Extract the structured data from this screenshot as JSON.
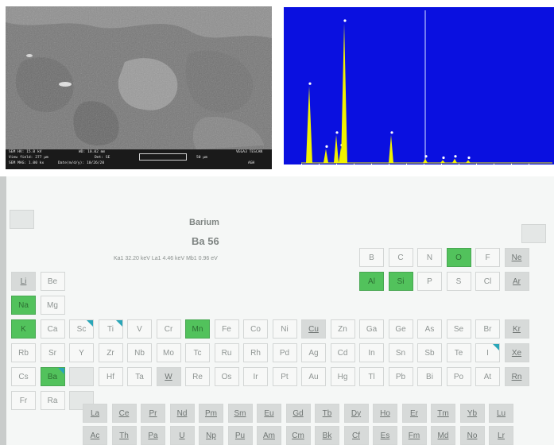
{
  "sem": {
    "row1": [
      "SEM HV: 15.0 kV",
      "WD: 10.02 mm",
      "VEGA3 TESCAN"
    ],
    "row2": [
      "View field: 277 µm",
      "Det: SE",
      "50 µm"
    ],
    "row3": [
      "SEM MAG: 1.00 kx",
      "Date(m/d/y): 10/26/20",
      "AGH"
    ]
  },
  "eds": {
    "colors": {
      "background": "#0a10e0",
      "peak": "#f2f200",
      "marker": "#ffffff",
      "cursor": "#b8c0ff"
    },
    "peaks_relative": [
      0.55,
      0.1,
      0.2,
      0.11,
      1.0,
      0.2,
      0.03,
      0.02,
      0.03,
      0.02
    ]
  },
  "periodic": {
    "info": {
      "name": "Barium",
      "symbol_line": "Ba 56",
      "lines": "Ka1 32.20 keV   La1 4.46 keV   Mb1 0.96 eV"
    },
    "elements": [
      {
        "s": "Li",
        "c": 0,
        "r": 1,
        "st": "grey ul"
      },
      {
        "s": "Be",
        "c": 1,
        "r": 1
      },
      {
        "s": "Na",
        "c": 0,
        "r": 2,
        "st": "sel"
      },
      {
        "s": "Mg",
        "c": 1,
        "r": 2
      },
      {
        "s": "K",
        "c": 0,
        "r": 3,
        "st": "sel"
      },
      {
        "s": "Ca",
        "c": 1,
        "r": 3
      },
      {
        "s": "Sc",
        "c": 2,
        "r": 3,
        "tri": true
      },
      {
        "s": "Ti",
        "c": 3,
        "r": 3,
        "tri": true
      },
      {
        "s": "V",
        "c": 4,
        "r": 3
      },
      {
        "s": "Cr",
        "c": 5,
        "r": 3
      },
      {
        "s": "Mn",
        "c": 6,
        "r": 3,
        "st": "sel"
      },
      {
        "s": "Fe",
        "c": 7,
        "r": 3
      },
      {
        "s": "Co",
        "c": 8,
        "r": 3
      },
      {
        "s": "Ni",
        "c": 9,
        "r": 3
      },
      {
        "s": "Cu",
        "c": 10,
        "r": 3,
        "st": "grey ul"
      },
      {
        "s": "Zn",
        "c": 11,
        "r": 3
      },
      {
        "s": "Ga",
        "c": 12,
        "r": 3
      },
      {
        "s": "Ge",
        "c": 13,
        "r": 3
      },
      {
        "s": "As",
        "c": 14,
        "r": 3
      },
      {
        "s": "Se",
        "c": 15,
        "r": 3
      },
      {
        "s": "Br",
        "c": 16,
        "r": 3
      },
      {
        "s": "Kr",
        "c": 17,
        "r": 3,
        "st": "grey ul"
      },
      {
        "s": "Rb",
        "c": 0,
        "r": 4
      },
      {
        "s": "Sr",
        "c": 1,
        "r": 4
      },
      {
        "s": "Y",
        "c": 2,
        "r": 4
      },
      {
        "s": "Zr",
        "c": 3,
        "r": 4
      },
      {
        "s": "Nb",
        "c": 4,
        "r": 4
      },
      {
        "s": "Mo",
        "c": 5,
        "r": 4
      },
      {
        "s": "Tc",
        "c": 6,
        "r": 4
      },
      {
        "s": "Ru",
        "c": 7,
        "r": 4
      },
      {
        "s": "Rh",
        "c": 8,
        "r": 4
      },
      {
        "s": "Pd",
        "c": 9,
        "r": 4
      },
      {
        "s": "Ag",
        "c": 10,
        "r": 4
      },
      {
        "s": "Cd",
        "c": 11,
        "r": 4
      },
      {
        "s": "In",
        "c": 12,
        "r": 4
      },
      {
        "s": "Sn",
        "c": 13,
        "r": 4
      },
      {
        "s": "Sb",
        "c": 14,
        "r": 4
      },
      {
        "s": "Te",
        "c": 15,
        "r": 4
      },
      {
        "s": "I",
        "c": 16,
        "r": 4,
        "tri": true
      },
      {
        "s": "Xe",
        "c": 17,
        "r": 4,
        "st": "grey ul"
      },
      {
        "s": "Cs",
        "c": 0,
        "r": 5
      },
      {
        "s": "Ba",
        "c": 1,
        "r": 5,
        "st": "sel",
        "tri": true
      },
      {
        "s": "",
        "c": 2,
        "r": 5,
        "st": "blank"
      },
      {
        "s": "Hf",
        "c": 3,
        "r": 5
      },
      {
        "s": "Ta",
        "c": 4,
        "r": 5
      },
      {
        "s": "W",
        "c": 5,
        "r": 5,
        "st": "grey ul"
      },
      {
        "s": "Re",
        "c": 6,
        "r": 5
      },
      {
        "s": "Os",
        "c": 7,
        "r": 5
      },
      {
        "s": "Ir",
        "c": 8,
        "r": 5
      },
      {
        "s": "Pt",
        "c": 9,
        "r": 5
      },
      {
        "s": "Au",
        "c": 10,
        "r": 5
      },
      {
        "s": "Hg",
        "c": 11,
        "r": 5
      },
      {
        "s": "Tl",
        "c": 12,
        "r": 5
      },
      {
        "s": "Pb",
        "c": 13,
        "r": 5
      },
      {
        "s": "Bi",
        "c": 14,
        "r": 5
      },
      {
        "s": "Po",
        "c": 15,
        "r": 5
      },
      {
        "s": "At",
        "c": 16,
        "r": 5
      },
      {
        "s": "Rn",
        "c": 17,
        "r": 5,
        "st": "grey ul"
      },
      {
        "s": "Fr",
        "c": 0,
        "r": 6
      },
      {
        "s": "Ra",
        "c": 1,
        "r": 6
      },
      {
        "s": "",
        "c": 2,
        "r": 6,
        "st": "blank"
      },
      {
        "s": "B",
        "c": 12,
        "r": 0
      },
      {
        "s": "C",
        "c": 13,
        "r": 0
      },
      {
        "s": "N",
        "c": 14,
        "r": 0
      },
      {
        "s": "O",
        "c": 15,
        "r": 0,
        "st": "sel"
      },
      {
        "s": "F",
        "c": 16,
        "r": 0
      },
      {
        "s": "Ne",
        "c": 17,
        "r": 0,
        "st": "grey ul"
      },
      {
        "s": "Al",
        "c": 12,
        "r": 1,
        "st": "sel"
      },
      {
        "s": "Si",
        "c": 13,
        "r": 1,
        "st": "sel"
      },
      {
        "s": "P",
        "c": 14,
        "r": 1
      },
      {
        "s": "S",
        "c": 15,
        "r": 1
      },
      {
        "s": "Cl",
        "c": 16,
        "r": 1
      },
      {
        "s": "Ar",
        "c": 17,
        "r": 1,
        "st": "grey ul"
      }
    ],
    "lanthanides": [
      "La",
      "Ce",
      "Pr",
      "Nd",
      "Pm",
      "Sm",
      "Eu",
      "Gd",
      "Tb",
      "Dy",
      "Ho",
      "Er",
      "Tm",
      "Yb",
      "Lu"
    ],
    "actinides": [
      "Ac",
      "Th",
      "Pa",
      "U",
      "Np",
      "Pu",
      "Am",
      "Cm",
      "Bk",
      "Cf",
      "Es",
      "Fm",
      "Md",
      "No",
      "Lr"
    ]
  }
}
